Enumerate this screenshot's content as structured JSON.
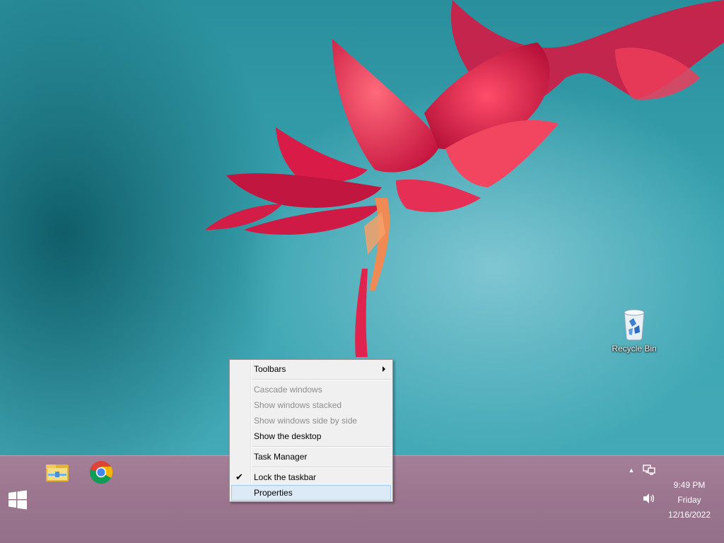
{
  "desktop": {
    "icons": [
      {
        "label": "Recycle Bin",
        "icon": "recycle-bin-icon"
      }
    ]
  },
  "context_menu": {
    "items": [
      {
        "label": "Toolbars",
        "enabled": true,
        "submenu": true
      },
      {
        "label": "Cascade windows",
        "enabled": false
      },
      {
        "label": "Show windows stacked",
        "enabled": false
      },
      {
        "label": "Show windows side by side",
        "enabled": false
      },
      {
        "label": "Show the desktop",
        "enabled": true
      },
      {
        "label": "Task Manager",
        "enabled": true
      },
      {
        "label": "Lock the taskbar",
        "enabled": true,
        "checked": true
      },
      {
        "label": "Properties",
        "enabled": true,
        "highlighted": true
      }
    ]
  },
  "taskbar": {
    "start_icon": "windows-logo-icon",
    "pinned": [
      {
        "name": "File Explorer",
        "icon": "file-explorer-icon"
      },
      {
        "name": "Google Chrome",
        "icon": "chrome-icon"
      }
    ],
    "tray": {
      "show_hidden_icon": "chevron-up-icon",
      "network_icon": "network-icon",
      "volume_icon": "speaker-icon"
    },
    "clock": {
      "time": "9:49 PM",
      "day": "Friday",
      "date": "12/16/2022"
    }
  },
  "colors": {
    "wallpaper_teal": "#3aa4b1",
    "flower_red": "#e0234a",
    "taskbar": "#9b758e",
    "menu_background": "#f0f0f0",
    "menu_highlight": "#dceaf8"
  }
}
